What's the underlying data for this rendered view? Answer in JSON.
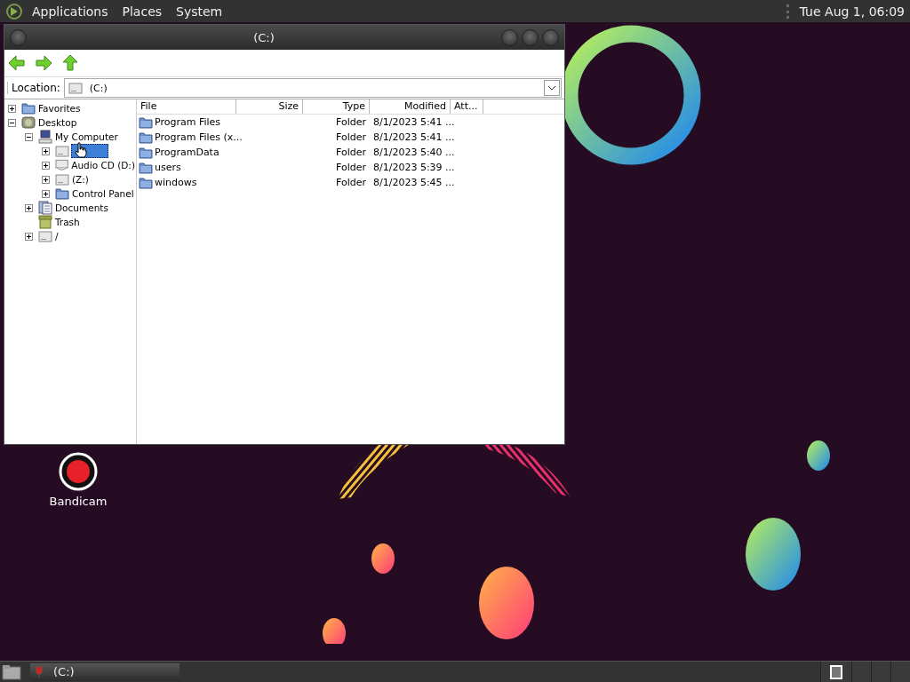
{
  "top_panel": {
    "menus": [
      "Applications",
      "Places",
      "System"
    ],
    "clock": "Tue Aug 1, 06:09"
  },
  "window": {
    "title": "(C:)",
    "location_label": "Location:",
    "location": "(C:)",
    "tree": [
      {
        "label": "Favorites",
        "kind": "folder",
        "expandable": true,
        "expanded": false,
        "selected": false
      },
      {
        "label": "Desktop",
        "kind": "desktop",
        "expandable": true,
        "expanded": true,
        "selected": false,
        "children": [
          {
            "label": "My Computer",
            "kind": "computer",
            "expandable": true,
            "expanded": true,
            "selected": false,
            "children": [
              {
                "kind": "drive",
                "expandable": true,
                "expanded": false,
                "selected": true
              },
              {
                "label": "Audio CD (D:)",
                "kind": "cd",
                "expandable": true,
                "expanded": false,
                "selected": false
              },
              {
                "label": " (Z:)",
                "kind": "drive",
                "expandable": true,
                "expanded": false,
                "selected": false
              },
              {
                "label": "Control Panel",
                "kind": "folder",
                "expandable": true,
                "expanded": false,
                "selected": false
              }
            ]
          },
          {
            "label": "Documents",
            "kind": "documents",
            "expandable": true,
            "expanded": false,
            "selected": false
          },
          {
            "label": "Trash",
            "kind": "trash",
            "expandable": false,
            "expanded": false,
            "selected": false
          },
          {
            "label": "/",
            "kind": "drive",
            "expandable": true,
            "expanded": false,
            "selected": false
          }
        ]
      }
    ],
    "columns": [
      "File",
      "Size",
      "Type",
      "Modified",
      "Att..."
    ],
    "rows": [
      {
        "name": "Program Files",
        "type": "Folder",
        "modified": "8/1/2023 5:41 ..."
      },
      {
        "name": "Program Files (x...",
        "type": "Folder",
        "modified": "8/1/2023 5:41 ..."
      },
      {
        "name": "ProgramData",
        "type": "Folder",
        "modified": "8/1/2023 5:40 ..."
      },
      {
        "name": "users",
        "type": "Folder",
        "modified": "8/1/2023 5:39 ..."
      },
      {
        "name": "windows",
        "type": "Folder",
        "modified": "8/1/2023 5:45 ..."
      }
    ]
  },
  "desktop_icons": [
    {
      "label": "Bandicam"
    }
  ],
  "taskbar": {
    "tasks": [
      {
        "label": "(C:)"
      }
    ],
    "workspaces": [
      {
        "selected": true
      },
      {
        "selected": false
      },
      {
        "selected": false
      },
      {
        "selected": false
      }
    ]
  }
}
